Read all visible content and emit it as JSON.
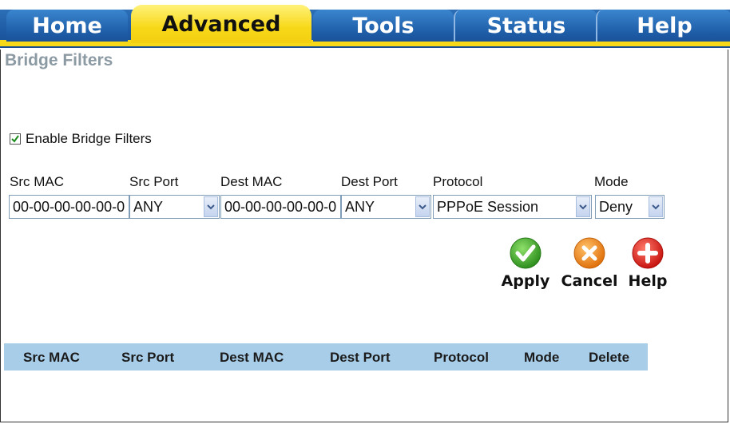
{
  "nav": {
    "tabs": [
      {
        "label": "Home"
      },
      {
        "label": "Advanced"
      },
      {
        "label": "Tools"
      },
      {
        "label": "Status"
      },
      {
        "label": "Help"
      }
    ],
    "active_tab": "Advanced"
  },
  "page": {
    "title": "Bridge Filters"
  },
  "enable": {
    "label": "Enable Bridge Filters",
    "checked": true
  },
  "form": {
    "labels": {
      "src_mac": "Src MAC",
      "src_port": "Src Port",
      "dest_mac": "Dest MAC",
      "dest_port": "Dest Port",
      "protocol": "Protocol",
      "mode": "Mode"
    },
    "values": {
      "src_mac": "00-00-00-00-00-0",
      "src_port": "ANY",
      "dest_mac": "00-00-00-00-00-0",
      "dest_port": "ANY",
      "protocol": "PPPoE Session",
      "mode": "Deny"
    }
  },
  "actions": {
    "apply": "Apply",
    "cancel": "Cancel",
    "help": "Help"
  },
  "table": {
    "headers": [
      "Src MAC",
      "Src Port",
      "Dest MAC",
      "Dest Port",
      "Protocol",
      "Mode",
      "Delete"
    ],
    "rows": []
  },
  "colors": {
    "tab_blue": "#1f5ea8",
    "tab_active_yellow": "#f7d818",
    "title_gray": "#8c9aa3",
    "table_header_blue": "#a8cde8",
    "apply_green": "#3aa829",
    "cancel_orange": "#ef8a1a",
    "help_red": "#e0201b"
  }
}
